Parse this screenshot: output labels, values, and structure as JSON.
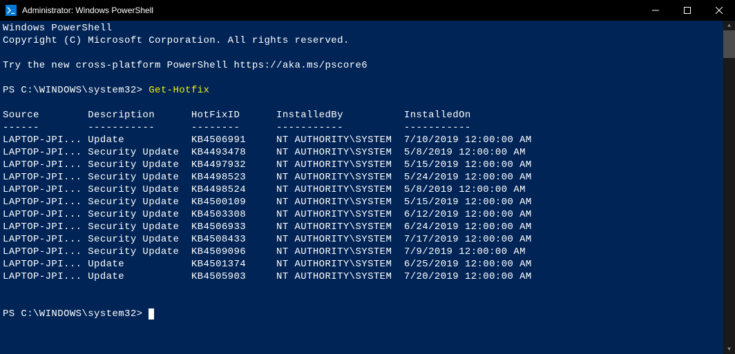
{
  "titlebar": {
    "title": "Administrator: Windows PowerShell"
  },
  "header": {
    "line1": "Windows PowerShell",
    "line2": "Copyright (C) Microsoft Corporation. All rights reserved.",
    "line3": "Try the new cross-platform PowerShell https://aka.ms/pscore6"
  },
  "prompt": "PS C:\\WINDOWS\\system32>",
  "command": "Get-Hotfix",
  "table": {
    "headers": [
      "Source",
      "Description",
      "HotFixID",
      "InstalledBy",
      "InstalledOn"
    ],
    "dividers": [
      "------",
      "-----------",
      "--------",
      "-----------",
      "-----------"
    ],
    "rows": [
      {
        "source": "LAPTOP-JPI...",
        "description": "Update",
        "hotfixid": "KB4506991",
        "installedby": "NT AUTHORITY\\SYSTEM",
        "installedon": "7/10/2019 12:00:00 AM"
      },
      {
        "source": "LAPTOP-JPI...",
        "description": "Security Update",
        "hotfixid": "KB4493478",
        "installedby": "NT AUTHORITY\\SYSTEM",
        "installedon": "5/8/2019 12:00:00 AM"
      },
      {
        "source": "LAPTOP-JPI...",
        "description": "Security Update",
        "hotfixid": "KB4497932",
        "installedby": "NT AUTHORITY\\SYSTEM",
        "installedon": "5/15/2019 12:00:00 AM"
      },
      {
        "source": "LAPTOP-JPI...",
        "description": "Security Update",
        "hotfixid": "KB4498523",
        "installedby": "NT AUTHORITY\\SYSTEM",
        "installedon": "5/24/2019 12:00:00 AM"
      },
      {
        "source": "LAPTOP-JPI...",
        "description": "Security Update",
        "hotfixid": "KB4498524",
        "installedby": "NT AUTHORITY\\SYSTEM",
        "installedon": "5/8/2019 12:00:00 AM"
      },
      {
        "source": "LAPTOP-JPI...",
        "description": "Security Update",
        "hotfixid": "KB4500109",
        "installedby": "NT AUTHORITY\\SYSTEM",
        "installedon": "5/15/2019 12:00:00 AM"
      },
      {
        "source": "LAPTOP-JPI...",
        "description": "Security Update",
        "hotfixid": "KB4503308",
        "installedby": "NT AUTHORITY\\SYSTEM",
        "installedon": "6/12/2019 12:00:00 AM"
      },
      {
        "source": "LAPTOP-JPI...",
        "description": "Security Update",
        "hotfixid": "KB4506933",
        "installedby": "NT AUTHORITY\\SYSTEM",
        "installedon": "6/24/2019 12:00:00 AM"
      },
      {
        "source": "LAPTOP-JPI...",
        "description": "Security Update",
        "hotfixid": "KB4508433",
        "installedby": "NT AUTHORITY\\SYSTEM",
        "installedon": "7/17/2019 12:00:00 AM"
      },
      {
        "source": "LAPTOP-JPI...",
        "description": "Security Update",
        "hotfixid": "KB4509096",
        "installedby": "NT AUTHORITY\\SYSTEM",
        "installedon": "7/9/2019 12:00:00 AM"
      },
      {
        "source": "LAPTOP-JPI...",
        "description": "Update",
        "hotfixid": "KB4501374",
        "installedby": "NT AUTHORITY\\SYSTEM",
        "installedon": "6/25/2019 12:00:00 AM"
      },
      {
        "source": "LAPTOP-JPI...",
        "description": "Update",
        "hotfixid": "KB4505903",
        "installedby": "NT AUTHORITY\\SYSTEM",
        "installedon": "7/20/2019 12:00:00 AM"
      }
    ]
  }
}
